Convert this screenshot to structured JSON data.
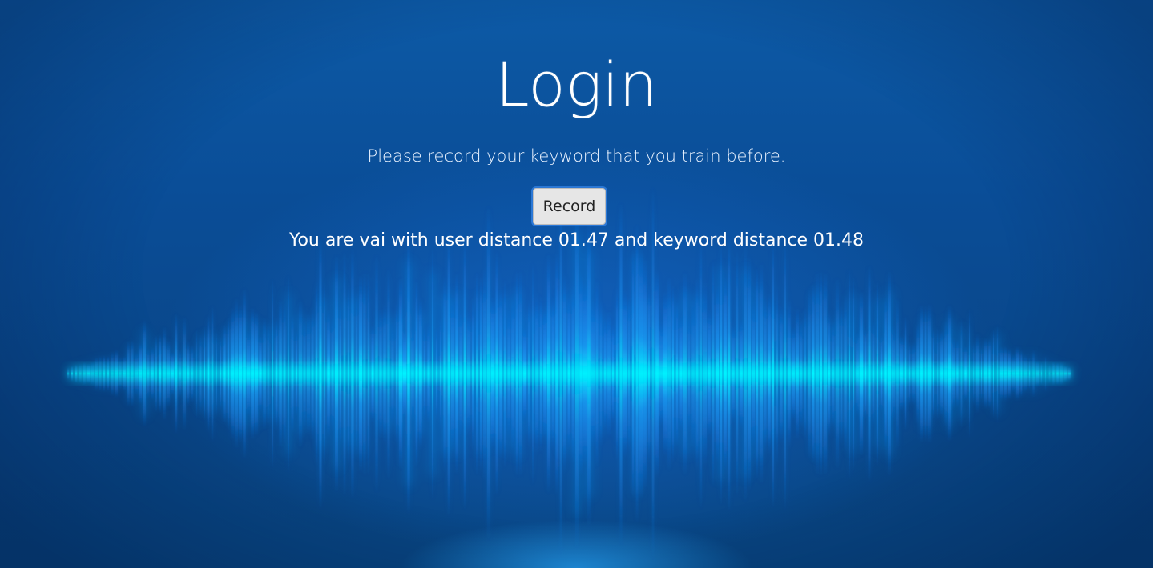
{
  "page": {
    "title": "Login",
    "instruction": "Please record your keyword that you train before.",
    "record_button_label": "Record",
    "result_message": "You are vai with user distance 01.47 and keyword distance 01.48"
  },
  "colors": {
    "background": "#0a4d97",
    "wave": "#00f0ff",
    "text": "#ffffff",
    "button": "#e6e6e6"
  },
  "background_image": {
    "semantic": "sound-wave-background"
  }
}
